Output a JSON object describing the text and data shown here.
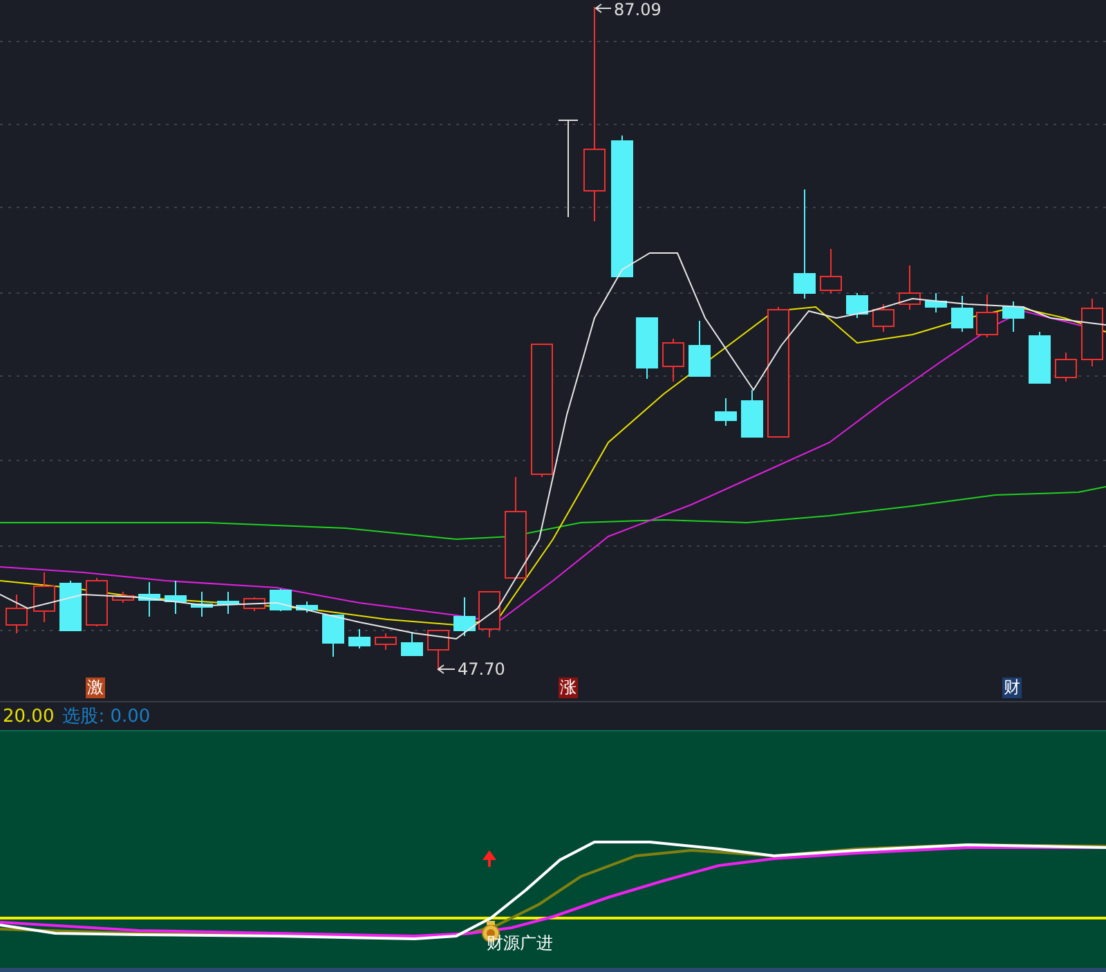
{
  "main_chart": {
    "high_label": "87.09",
    "low_label": "47.70",
    "markers": [
      {
        "label": "激",
        "color": "#b5461c"
      },
      {
        "label": "涨",
        "color": "#8a1212"
      },
      {
        "label": "财",
        "color": "#1c3d6e"
      }
    ]
  },
  "info_bar": {
    "value": "20.00",
    "stock_pick_label": "选股:",
    "stock_pick_value": "0.00"
  },
  "indicator_panel": {
    "signal_label": "财源广进"
  }
}
